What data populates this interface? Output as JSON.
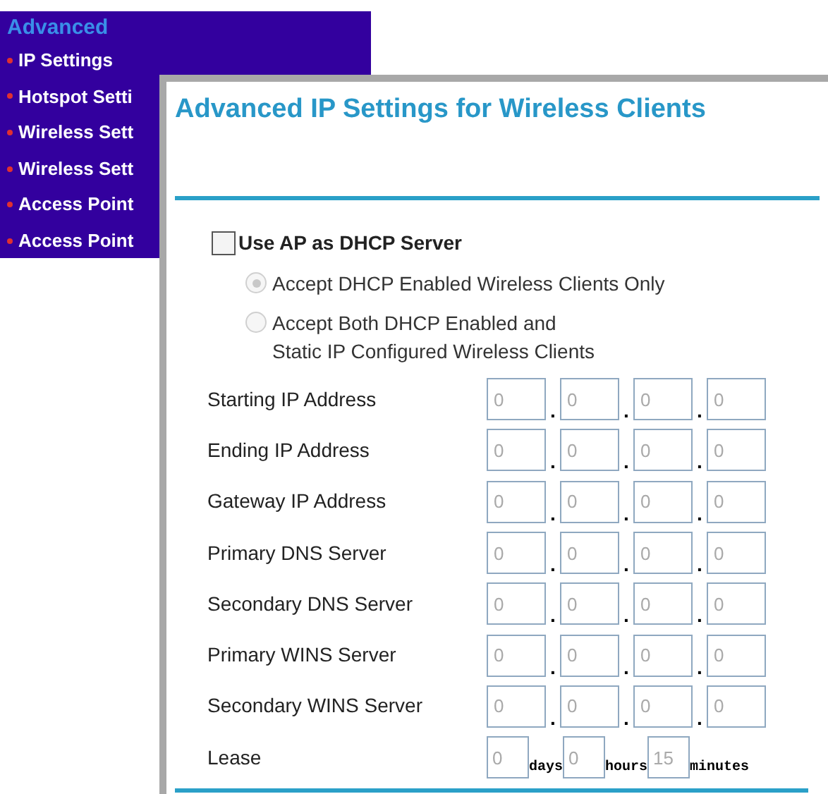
{
  "sidebar": {
    "title": "Advanced",
    "items": [
      {
        "label": "IP Settings"
      },
      {
        "label": "Hotspot Setti"
      },
      {
        "label": "Wireless Sett"
      },
      {
        "label": "Wireless Sett"
      },
      {
        "label": "Access Point"
      },
      {
        "label": "Access Point"
      }
    ]
  },
  "dialog": {
    "title": "Advanced IP Settings for Wireless Clients",
    "dhcp_server": {
      "label": "Use AP as DHCP Server",
      "checked": false
    },
    "radios": [
      {
        "label": "Accept DHCP Enabled Wireless Clients Only",
        "selected": true,
        "disabled": true
      },
      {
        "label": "Accept Both DHCP Enabled and\nStatic IP Configured Wireless Clients",
        "selected": false,
        "disabled": true
      }
    ],
    "fields": [
      {
        "label": "Starting IP Address",
        "octets": [
          "0",
          "0",
          "0",
          "0"
        ],
        "disabled": true
      },
      {
        "label": "Ending IP Address",
        "octets": [
          "0",
          "0",
          "0",
          "0"
        ],
        "disabled": true
      },
      {
        "label": "Gateway IP Address",
        "octets": [
          "0",
          "0",
          "0",
          "0"
        ],
        "disabled": true
      },
      {
        "label": "Primary DNS Server",
        "octets": [
          "0",
          "0",
          "0",
          "0"
        ],
        "disabled": true
      },
      {
        "label": "Secondary DNS Server",
        "octets": [
          "0",
          "0",
          "0",
          "0"
        ],
        "disabled": true
      },
      {
        "label": "Primary WINS Server",
        "octets": [
          "0",
          "0",
          "0",
          "0"
        ],
        "disabled": true
      },
      {
        "label": "Secondary WINS Server",
        "octets": [
          "0",
          "0",
          "0",
          "0"
        ],
        "disabled": true
      }
    ],
    "separator": ".",
    "lease": {
      "label": "Lease",
      "disabled": true,
      "parts": [
        {
          "value": "0",
          "unit": "days"
        },
        {
          "value": "0",
          "unit": "hours"
        },
        {
          "value": "15",
          "unit": "minutes"
        }
      ]
    }
  }
}
